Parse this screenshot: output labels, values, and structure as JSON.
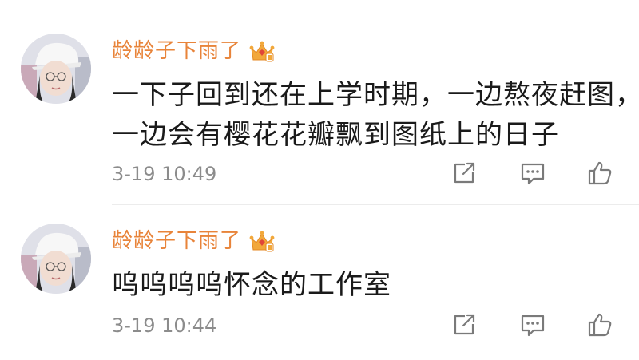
{
  "comments": [
    {
      "username": "龄龄子下雨了",
      "text_lines": [
        "一下子回到还在上学时期，一边熬夜赶图，",
        "一边会有樱花花瓣飘到图纸上的日子"
      ],
      "timestamp": "3-19 10:49",
      "badge_icon": "crown-vip-icon"
    },
    {
      "username": "龄龄子下雨了",
      "text_lines": [
        "呜呜呜呜怀念的工作室"
      ],
      "timestamp": "3-19 10:44",
      "badge_icon": "crown-vip-icon"
    }
  ],
  "colors": {
    "username": "#e8843a",
    "text": "#1a1a1a",
    "meta": "#8c8c8c",
    "badge": "#f2a83b",
    "icon": "#7a7a7a",
    "divider": "#ececec"
  }
}
